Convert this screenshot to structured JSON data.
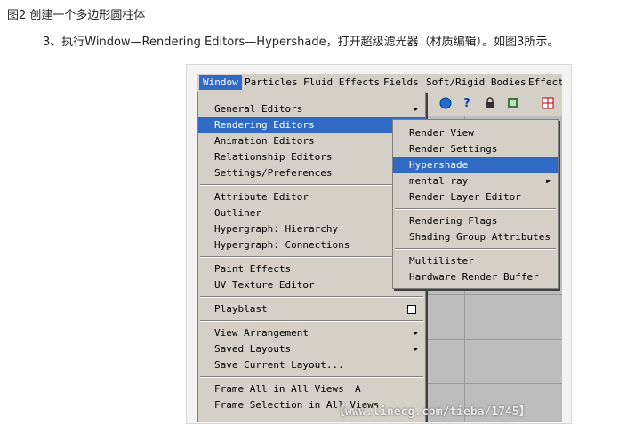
{
  "caption": "图2 创建一个多边形圆柱体",
  "step_text": "3、执行Window—Rendering Editors—Hypershade，打开超级滤光器（材质编辑）。如图3所示。",
  "menubar": {
    "items": [
      "Window",
      "Particles",
      "Fluid Effects",
      "Fields",
      "Soft/Rigid Bodies",
      "Effect"
    ]
  },
  "window_menu": {
    "items": [
      {
        "label": "General Editors"
      },
      {
        "label": "Rendering Editors"
      },
      {
        "label": "Animation Editors"
      },
      {
        "label": "Relationship Editors"
      },
      {
        "label": "Settings/Preferences"
      },
      {
        "label": "Attribute Editor"
      },
      {
        "label": "Outliner"
      },
      {
        "label": "Hypergraph: Hierarchy"
      },
      {
        "label": "Hypergraph: Connections"
      },
      {
        "label": "Paint Effects"
      },
      {
        "label": "UV Texture Editor"
      },
      {
        "label": "Playblast"
      },
      {
        "label": "View Arrangement"
      },
      {
        "label": "Saved Layouts"
      },
      {
        "label": "Save Current Layout..."
      },
      {
        "label": "Frame All in All Views",
        "shortcut": "A"
      },
      {
        "label": "Frame Selection in All Views"
      }
    ]
  },
  "rendering_submenu": {
    "items": [
      {
        "label": "Render View"
      },
      {
        "label": "Render Settings"
      },
      {
        "label": "Hypershade"
      },
      {
        "label": "mental ray"
      },
      {
        "label": "Render Layer Editor"
      },
      {
        "label": "Rendering Flags"
      },
      {
        "label": "Shading Group Attributes"
      },
      {
        "label": "Multilister"
      },
      {
        "label": "Hardware Render Buffer"
      }
    ]
  },
  "toolbar": {
    "icons": [
      "sphere-icon",
      "help-icon",
      "lock-icon",
      "select-icon",
      "grid-icon"
    ]
  },
  "watermark": "【www.linecg.com/tieba/1745】",
  "colors": {
    "highlight": "#316ac5",
    "menu_bg": "#d4d0c8"
  }
}
